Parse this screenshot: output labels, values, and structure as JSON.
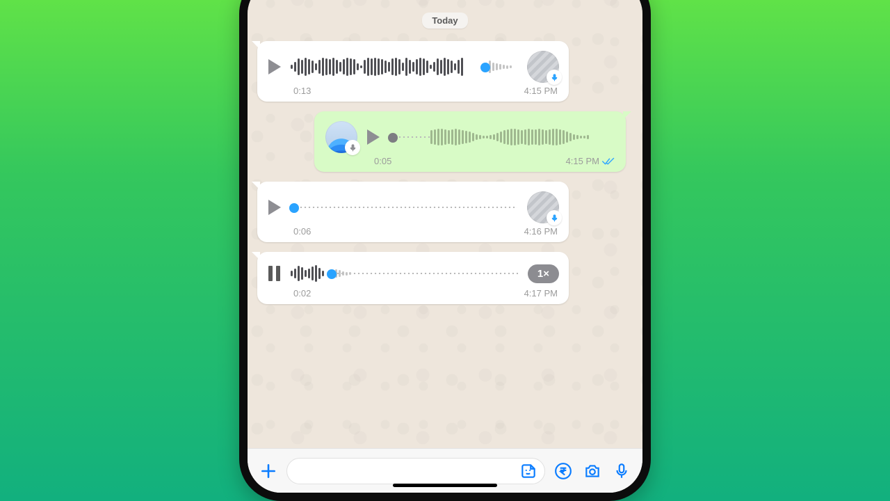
{
  "date_label": "Today",
  "messages": [
    {
      "id": "m1",
      "direction": "incoming",
      "state": "playing-near-end",
      "duration_label": "0:13",
      "timestamp": "4:15 PM",
      "progress": 0.86,
      "avatar": "keyboard",
      "show_speed": false,
      "waveform": "full",
      "read_receipt": null
    },
    {
      "id": "m2",
      "direction": "outgoing",
      "state": "idle",
      "duration_label": "0:05",
      "timestamp": "4:15 PM",
      "progress": 0.0,
      "avatar": "blue-wave",
      "show_speed": false,
      "waveform": "muted-outgoing",
      "read_receipt": "read"
    },
    {
      "id": "m3",
      "direction": "incoming",
      "state": "idle",
      "duration_label": "0:06",
      "timestamp": "4:16 PM",
      "progress": 0.0,
      "avatar": "keyboard",
      "show_speed": false,
      "waveform": "dots-only",
      "read_receipt": null
    },
    {
      "id": "m4",
      "direction": "incoming",
      "state": "playing",
      "duration_label": "0:02",
      "timestamp": "4:17 PM",
      "progress": 0.18,
      "avatar": null,
      "show_speed": true,
      "speed_label": "1×",
      "waveform": "partial",
      "read_receipt": null
    }
  ],
  "input": {
    "placeholder": ""
  },
  "colors": {
    "accent_blue": "#0a7cff",
    "play_knob": "#2aa3ff",
    "incoming_bg": "#ffffff",
    "outgoing_bg": "#d8fbc6",
    "chat_bg": "#eee6dc"
  },
  "icons": {
    "plus": "plus-icon",
    "sticker": "sticker-icon",
    "rupee": "rupee-icon",
    "camera": "camera-icon",
    "mic": "mic-icon"
  }
}
